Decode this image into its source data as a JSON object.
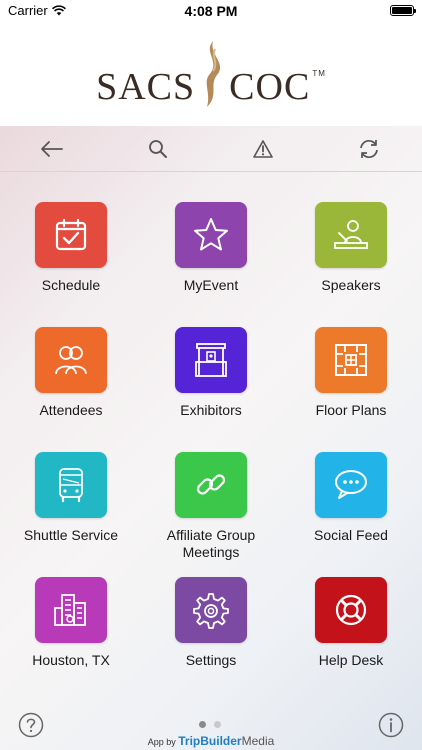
{
  "status": {
    "carrier": "Carrier",
    "time": "4:08 PM"
  },
  "header": {
    "logo_left": "SACS",
    "logo_right": "COC",
    "logo_tm": "TM"
  },
  "tiles": [
    {
      "label": "Schedule",
      "color": "#e44b3f",
      "icon": "calendar-check-icon"
    },
    {
      "label": "MyEvent",
      "color": "#8e44ad",
      "icon": "star-icon"
    },
    {
      "label": "Speakers",
      "color": "#9ab73a",
      "icon": "speaker-podium-icon"
    },
    {
      "label": "Attendees",
      "color": "#ed6a2b",
      "icon": "people-icon"
    },
    {
      "label": "Exhibitors",
      "color": "#5524d6",
      "icon": "booth-icon"
    },
    {
      "label": "Floor Plans",
      "color": "#ec7a2a",
      "icon": "floor-plan-icon"
    },
    {
      "label": "Shuttle Service",
      "color": "#22b7c4",
      "icon": "bus-icon"
    },
    {
      "label": "Affiliate Group Meetings",
      "color": "#3bc84a",
      "icon": "link-icon"
    },
    {
      "label": "Social Feed",
      "color": "#22b4e8",
      "icon": "chat-bubble-icon"
    },
    {
      "label": "Houston, TX",
      "color": "#b83ab8",
      "icon": "city-buildings-icon"
    },
    {
      "label": "Settings",
      "color": "#7d4aa3",
      "icon": "gear-icon"
    },
    {
      "label": "Help Desk",
      "color": "#c4121b",
      "icon": "lifebuoy-icon"
    }
  ],
  "footer": {
    "app_by": "App by",
    "brand_trip": "TripBuilder",
    "brand_media": "Media",
    "page_count": 2,
    "active_page": 1
  }
}
